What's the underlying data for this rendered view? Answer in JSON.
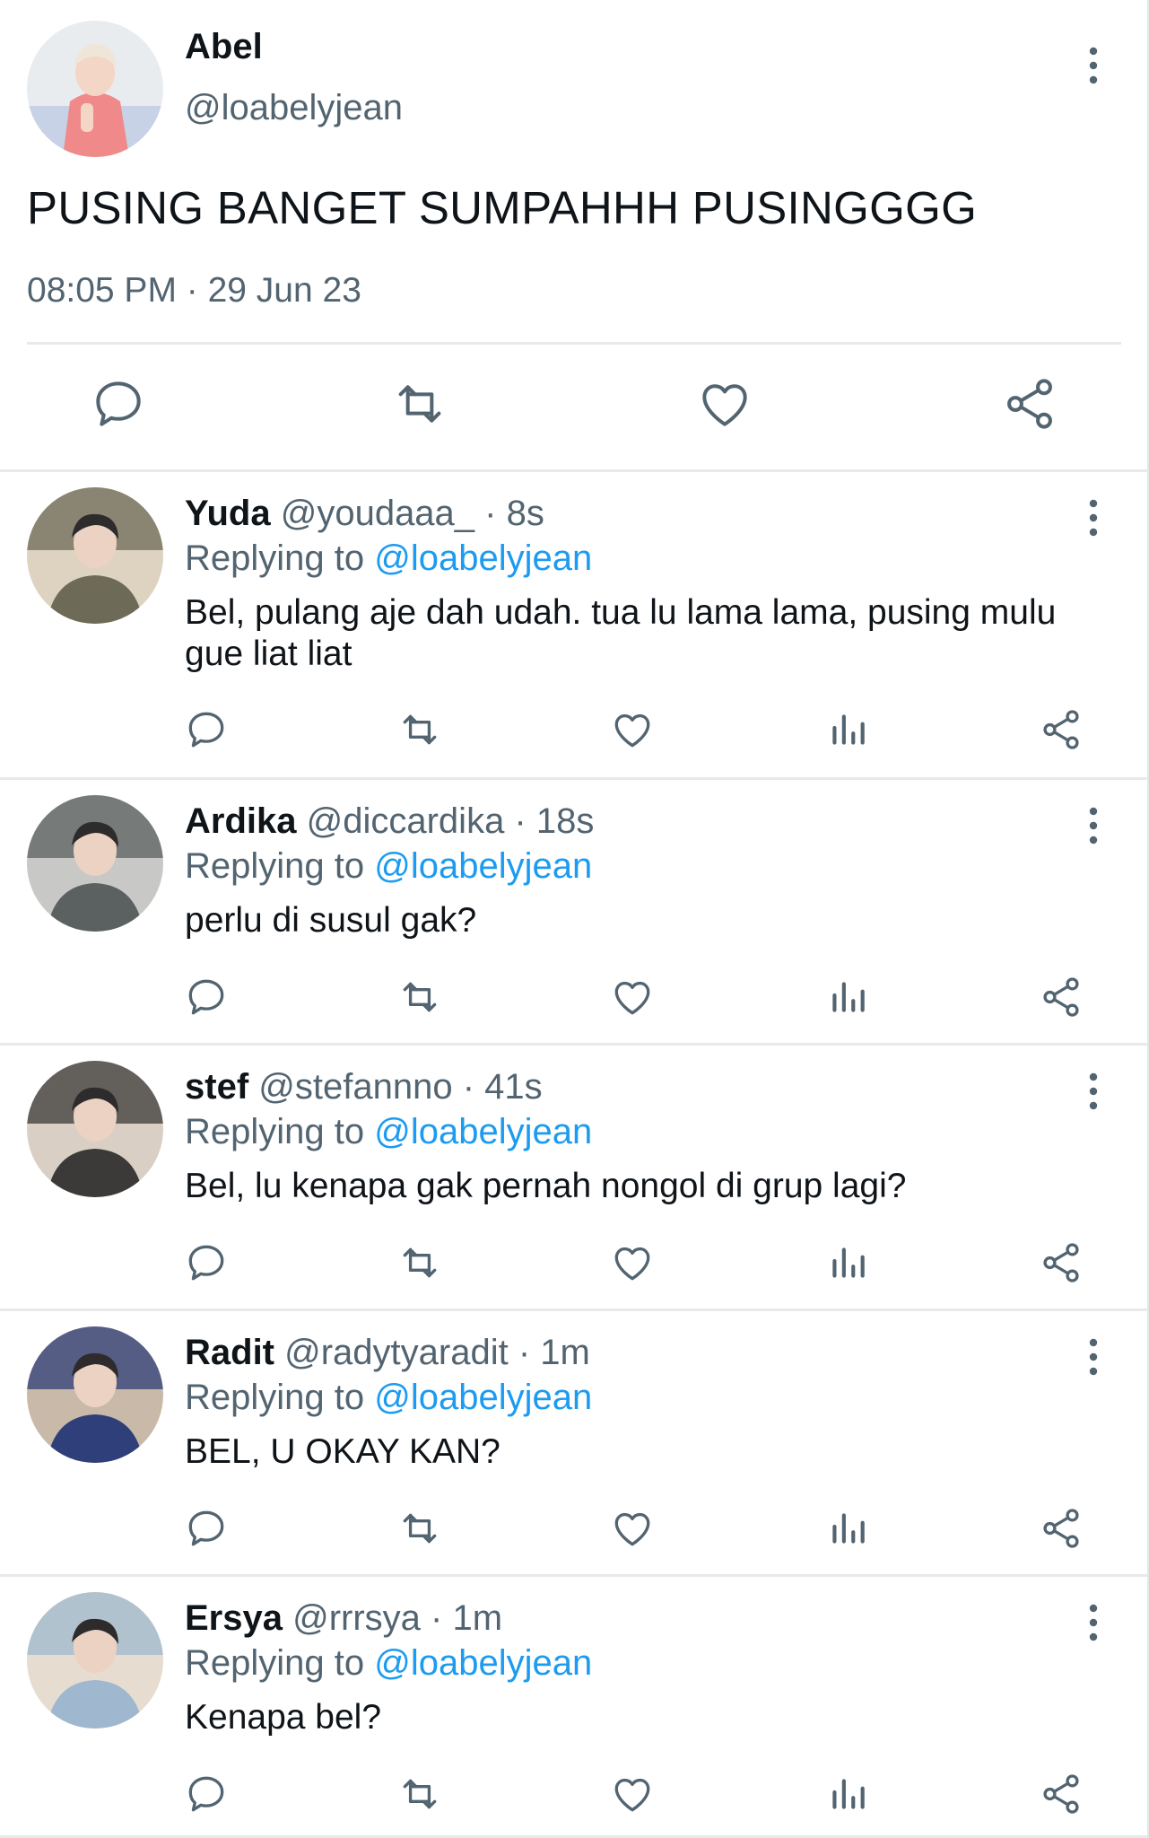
{
  "tweet": {
    "name": "Abel",
    "handle": "@loabelyjean",
    "text": "PUSING BANGET SUMPAHHH PUSINGGGG",
    "timestamp": "08:05 PM · 29 Jun 23",
    "actions": [
      "reply-icon",
      "retweet-icon",
      "like-icon",
      "share-icon"
    ]
  },
  "replies": [
    {
      "name": "Yuda",
      "meta": "@youdaaa_ · 8s",
      "replying_prefix": "Replying to",
      "replying_to": "@loabelyjean",
      "text": "Bel, pulang aje dah udah. tua lu lama lama, pusing mulu gue liat liat",
      "avatar_colors": [
        "#6d6a58",
        "#ddd3c0"
      ]
    },
    {
      "name": "Ardika",
      "meta": "@diccardika · 18s",
      "replying_prefix": "Replying to",
      "replying_to": "@loabelyjean",
      "text": "perlu di susul gak?",
      "avatar_colors": [
        "#5b6060",
        "#c8c9c6"
      ]
    },
    {
      "name": "stef",
      "meta": "@stefannno · 41s",
      "replying_prefix": "Replying to",
      "replying_to": "@loabelyjean",
      "text": "Bel, lu kenapa gak pernah nongol di grup lagi?",
      "avatar_colors": [
        "#3b3a38",
        "#d9cfc4"
      ]
    },
    {
      "name": "Radit",
      "meta": "@radytyaradit · 1m",
      "replying_prefix": "Replying to",
      "replying_to": "@loabelyjean",
      "text": "BEL, U OKAY KAN?",
      "avatar_colors": [
        "#2e3f7a",
        "#c9b9a8"
      ]
    },
    {
      "name": "Ersya",
      "meta": "@rrrsya · 1m",
      "replying_prefix": "Replying to",
      "replying_to": "@loabelyjean",
      "text": "Kenapa bel?",
      "avatar_colors": [
        "#9fb8cf",
        "#e6ddd0"
      ]
    }
  ],
  "reply_actions": [
    "reply-icon",
    "retweet-icon",
    "like-icon",
    "views-icon",
    "share-icon"
  ],
  "colors": {
    "link": "#1d9bf0",
    "secondary_text": "#536471",
    "icon": "#536471",
    "divider": "#e7e9ea"
  }
}
